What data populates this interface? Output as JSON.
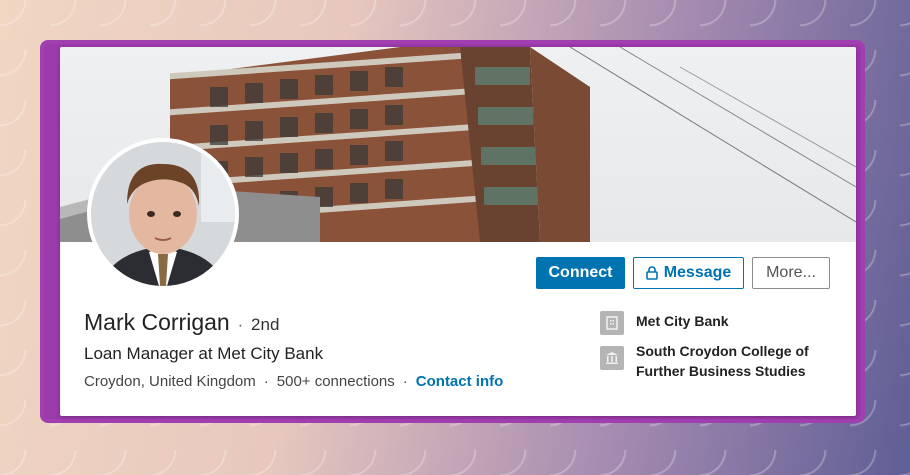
{
  "profile": {
    "name": "Mark Corrigan",
    "degree": "2nd",
    "separator": "·",
    "headline": "Loan Manager at Met City Bank",
    "location": "Croydon, United Kingdom",
    "connections": "500+ connections",
    "contact_info": "Contact info"
  },
  "actions": {
    "connect": "Connect",
    "message": "Message",
    "more": "More..."
  },
  "side": {
    "company": "Met City Bank",
    "education": "South Croydon College of Further Business Studies"
  },
  "colors": {
    "accent": "#0073b1",
    "frame": "#a13fb0"
  }
}
